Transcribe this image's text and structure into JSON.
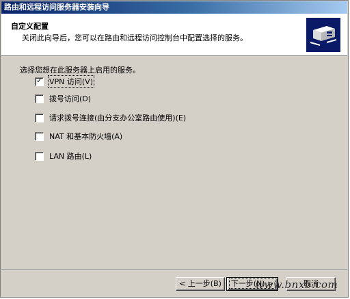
{
  "window": {
    "title": "路由和远程访问服务器安装向导"
  },
  "header": {
    "title": "自定义配置",
    "subtitle": "关闭此向导后，您可以在路由和远程访问控制台中配置选择的服务。",
    "icon": "server-network-icon"
  },
  "main": {
    "instruction": "选择您想在此服务器上启用的服务。",
    "options": [
      {
        "label": "VPN 访问(V)",
        "checked": true
      },
      {
        "label": "拨号访问(D)",
        "checked": false
      },
      {
        "label": "请求拨号连接(由分支办公室路由使用)(E)",
        "checked": false
      },
      {
        "label": "NAT 和基本防火墙(A)",
        "checked": false
      },
      {
        "label": "LAN 路由(L)",
        "checked": false
      }
    ]
  },
  "buttons": {
    "back": "< 上一步(B)",
    "next": "下一步(N) >",
    "cancel": "取消"
  },
  "watermark": "www.bnxb.com"
}
